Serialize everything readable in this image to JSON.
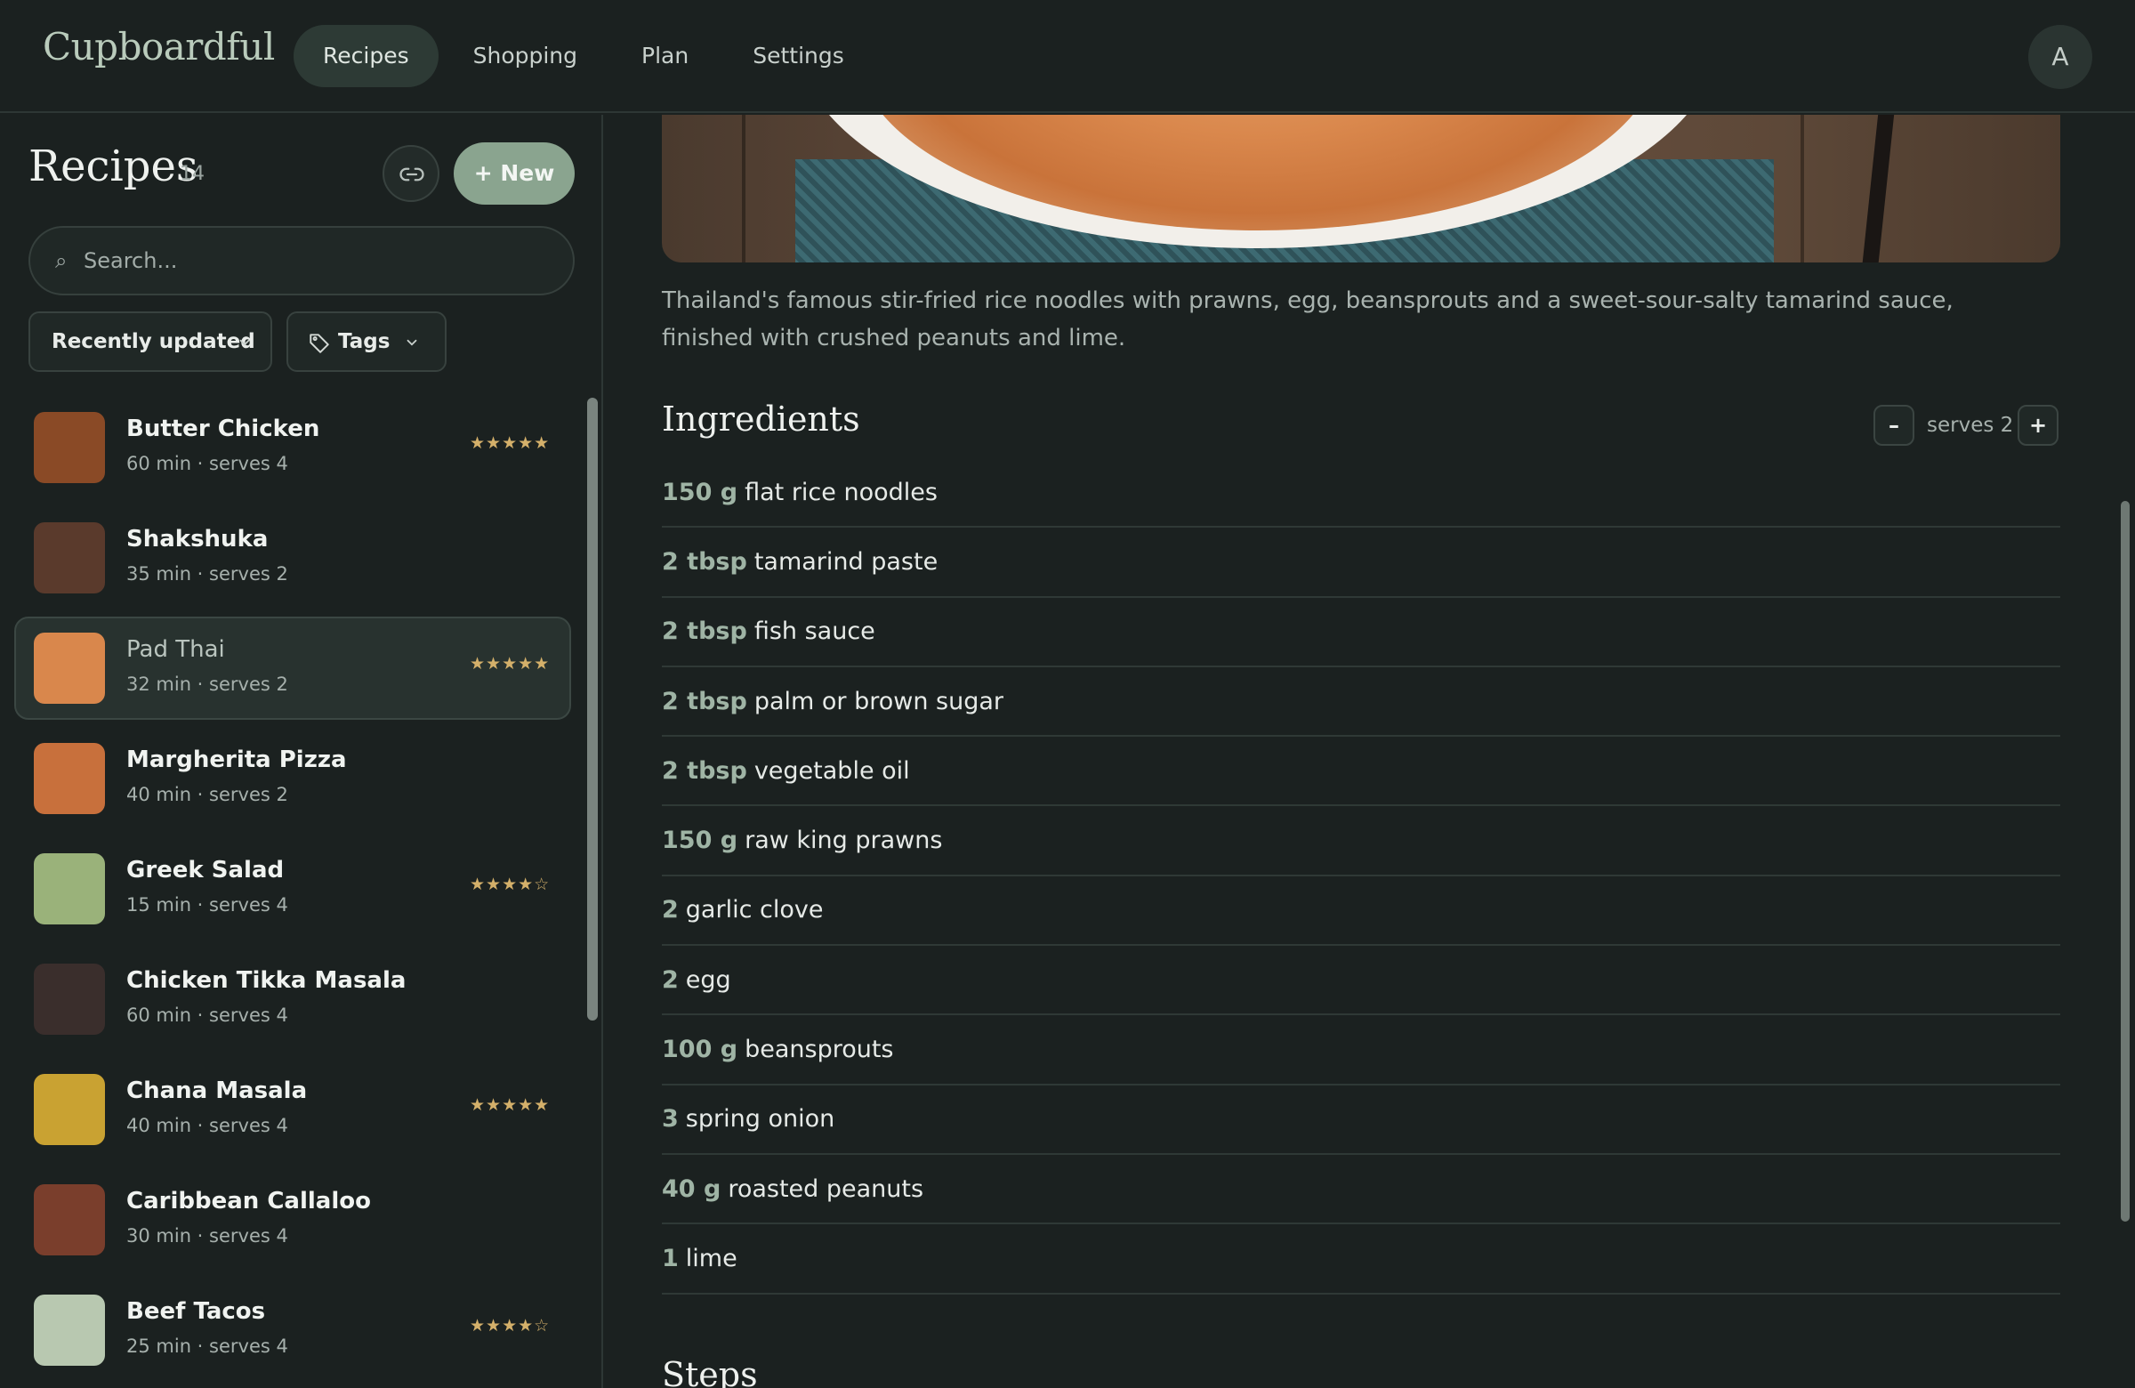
{
  "app": {
    "brand": "Cupboardful",
    "avatar_initial": "A"
  },
  "nav": {
    "tabs": [
      {
        "label": "Recipes",
        "active": true
      },
      {
        "label": "Shopping",
        "active": false
      },
      {
        "label": "Plan",
        "active": false
      },
      {
        "label": "Settings",
        "active": false
      }
    ]
  },
  "sidebar": {
    "title": "Recipes",
    "count": "14",
    "new_label": "+ New",
    "search_placeholder": "Search...",
    "sort_label": "Recently updated",
    "tags_label": "Tags",
    "recipes": [
      {
        "name": "Butter Chicken",
        "meta": "60 min · serves 4",
        "stars": "★★★★★",
        "rating": 5,
        "thumb": "#8a4a26",
        "selected": false
      },
      {
        "name": "Shakshuka",
        "meta": "35 min · serves 2",
        "stars": "",
        "rating": 0,
        "thumb": "#5a3a2c",
        "selected": false
      },
      {
        "name": "Pad Thai",
        "meta": "32 min · serves 2",
        "stars": "★★★★★",
        "rating": 5,
        "thumb": "#d9874c",
        "selected": true
      },
      {
        "name": "Margherita Pizza",
        "meta": "40 min · serves 2",
        "stars": "",
        "rating": 0,
        "thumb": "#c8703c",
        "selected": false
      },
      {
        "name": "Greek Salad",
        "meta": "15 min · serves 4",
        "stars": "★★★★☆",
        "rating": 4,
        "thumb": "#9ab27a",
        "selected": false
      },
      {
        "name": "Chicken Tikka Masala",
        "meta": "60 min · serves 4",
        "stars": "",
        "rating": 0,
        "thumb": "#3a2e2c",
        "selected": false
      },
      {
        "name": "Chana Masala",
        "meta": "40 min · serves 4",
        "stars": "★★★★★",
        "rating": 5,
        "thumb": "#c9a232",
        "selected": false
      },
      {
        "name": "Caribbean Callaloo",
        "meta": "30 min · serves 4",
        "stars": "",
        "rating": 0,
        "thumb": "#7a3e2c",
        "selected": false
      },
      {
        "name": "Beef Tacos",
        "meta": "25 min · serves 4",
        "stars": "★★★★☆",
        "rating": 4,
        "thumb": "#b8c8b0",
        "selected": false
      }
    ]
  },
  "recipe": {
    "description": "Thailand's famous stir-fried rice noodles with prawns, egg, beansprouts and a sweet-sour-salty tamarind sauce, finished with crushed peanuts and lime.",
    "ingredients_heading": "Ingredients",
    "serves_label": "serves 2",
    "minus_label": "–",
    "plus_label": "+",
    "ingredients": [
      {
        "qty": "150 g",
        "name": "flat rice noodles"
      },
      {
        "qty": "2 tbsp",
        "name": "tamarind paste"
      },
      {
        "qty": "2 tbsp",
        "name": "fish sauce"
      },
      {
        "qty": "2 tbsp",
        "name": "palm or brown sugar"
      },
      {
        "qty": "2 tbsp",
        "name": "vegetable oil"
      },
      {
        "qty": "150 g",
        "name": "raw king prawns"
      },
      {
        "qty": "2",
        "name": "garlic clove"
      },
      {
        "qty": "2",
        "name": "egg"
      },
      {
        "qty": "100 g",
        "name": "beansprouts"
      },
      {
        "qty": "3",
        "name": "spring onion"
      },
      {
        "qty": "40 g",
        "name": "roasted peanuts"
      },
      {
        "qty": "1",
        "name": "lime"
      }
    ],
    "steps_heading": "Steps"
  }
}
